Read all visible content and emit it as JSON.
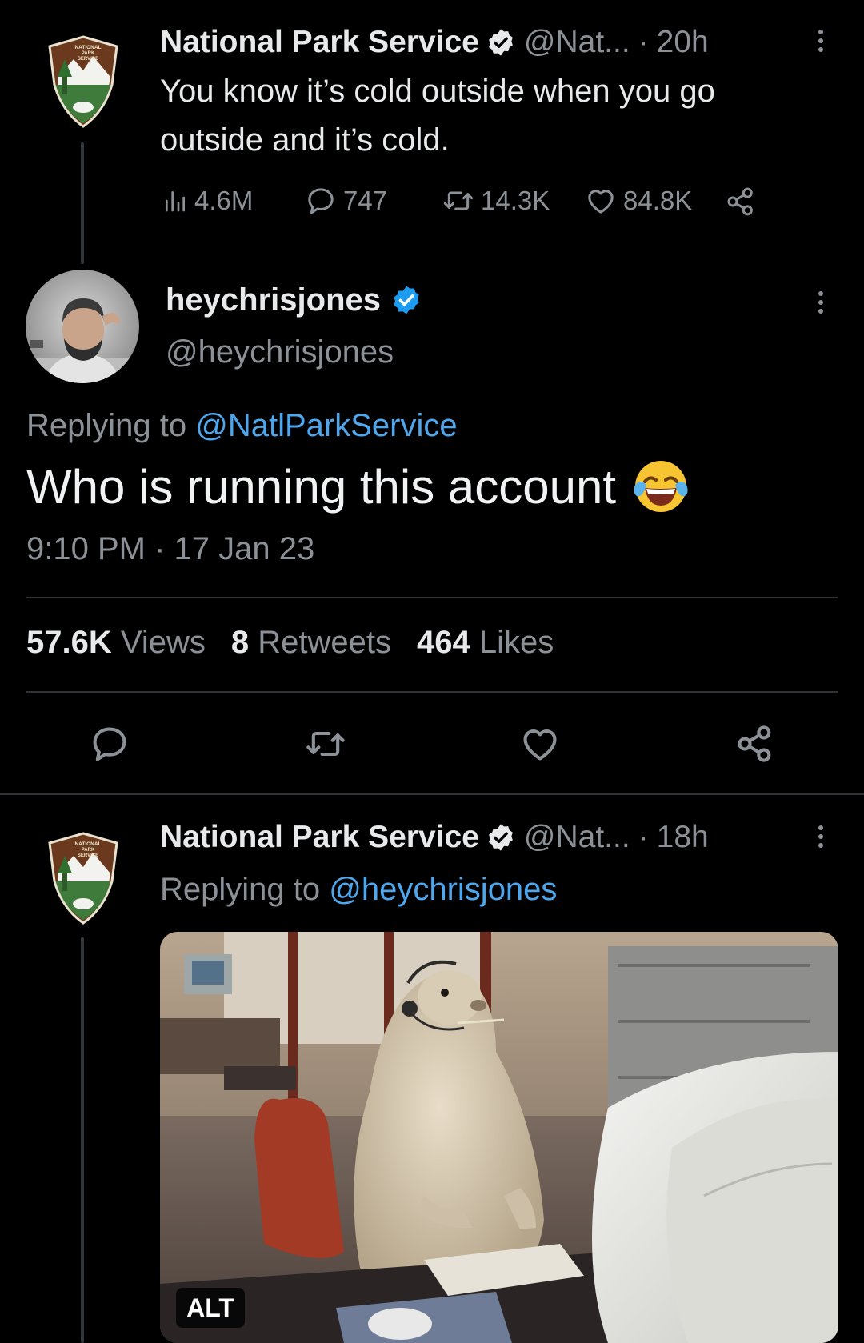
{
  "tweet1": {
    "display_name": "National Park Service",
    "handle": "@Nat...",
    "separator": "·",
    "time": "20h",
    "text": "You know it’s cold outside when you go outside and it’s cold.",
    "views": "4.6M",
    "replies": "747",
    "retweets": "14.3K",
    "likes": "84.8K"
  },
  "reply": {
    "display_name": "heychrisjones",
    "handle": "@heychrisjones",
    "replying_prefix": "Replying to",
    "replying_to": "@NatlParkService",
    "text": "Who is running this account",
    "emoji": "😂",
    "timestamp": "9:10 PM · 17 Jan 23",
    "stats": {
      "views_count": "57.6K",
      "views_label": "Views",
      "retweets_count": "8",
      "retweets_label": "Retweets",
      "likes_count": "464",
      "likes_label": "Likes"
    }
  },
  "tweet3": {
    "display_name": "National Park Service",
    "handle": "@Nat...",
    "separator": "·",
    "time": "18h",
    "replying_prefix": "Replying to",
    "replying_to": "@heychrisjones",
    "media_alt_badge": "ALT"
  },
  "logo_text": [
    "NATIONAL",
    "PARK",
    "SERVICE"
  ],
  "colors": {
    "background": "#000000",
    "text": "#e7e9ea",
    "muted": "#8b9197",
    "link": "#4ea6ec",
    "verified": "#1d9bf0",
    "divider": "#2f3336"
  },
  "icons": [
    "nps-arrowhead-logo",
    "verified-badge-icon",
    "more-options-icon",
    "views-chart-icon",
    "reply-icon",
    "retweet-icon",
    "like-icon",
    "share-icon",
    "avatar-photo",
    "prairie-dog-photo"
  ]
}
